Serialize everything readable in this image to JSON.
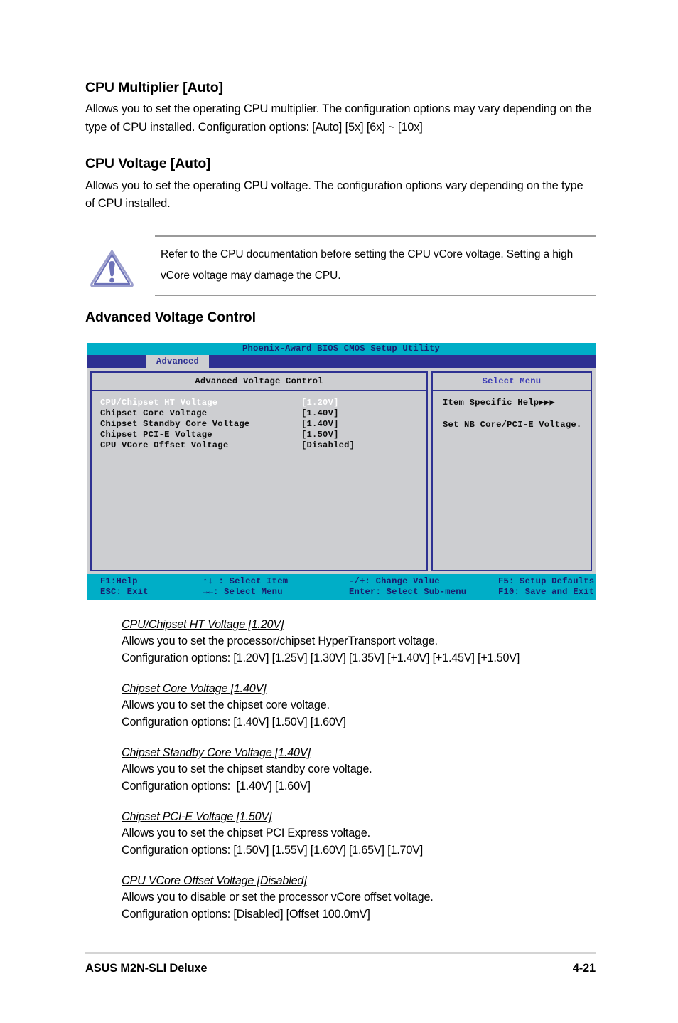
{
  "sections": [
    {
      "heading": "CPU Multiplier [Auto]",
      "body": "Allows you to set the operating CPU multiplier. The configuration options may vary depending on the type of CPU installed. Configuration options: [Auto] [5x] [6x] ~ [10x]"
    },
    {
      "heading": "CPU Voltage [Auto]",
      "body": "Allows you to set the operating CPU voltage. The configuration options vary depending on the type of CPU installed."
    }
  ],
  "note": {
    "icon": "warning-triangle-icon",
    "text": "Refer to the CPU documentation before setting the CPU vCore voltage. Setting a high vCore voltage may damage the CPU.",
    "icon_color": "#7b7fc4"
  },
  "advanced_heading": "Advanced Voltage Control",
  "bios": {
    "title": "Phoenix-Award BIOS CMOS Setup Utility",
    "tab": "Advanced",
    "left_pane_title": "Advanced Voltage Control",
    "right_pane_title": "Select Menu",
    "options": [
      {
        "label": "CPU/Chipset HT Voltage",
        "value": "[1.20V]",
        "selected": true
      },
      {
        "label": "Chipset Core Voltage",
        "value": "[1.40V]",
        "selected": false
      },
      {
        "label": "Chipset Standby Core Voltage",
        "value": "[1.40V]",
        "selected": false
      },
      {
        "label": "Chipset PCI-E Voltage",
        "value": "[1.50V]",
        "selected": false
      },
      {
        "label": "CPU VCore Offset Voltage",
        "value": "[Disabled]",
        "selected": false
      }
    ],
    "help_title": "Item Specific Help▶▶▶",
    "help_text": "Set NB Core/PCI-E Voltage.",
    "footer": {
      "row1": [
        "F1:Help",
        "↑↓ : Select Item",
        "-/+: Change Value",
        "F5: Setup Defaults"
      ],
      "row2": [
        "ESC: Exit",
        "→←: Select Menu",
        "Enter: Select Sub-menu",
        "F10: Save and Exit"
      ]
    },
    "colors": {
      "titlebar": "#00aec7",
      "tabbar": "#2e3192",
      "panel": "#cdced1",
      "border": "#2e3192",
      "footer": "#00aec7",
      "accent_text": "#3b3bb5"
    }
  },
  "details": [
    {
      "heading": "CPU/Chipset HT Voltage [1.20V]",
      "desc": "Allows you to set the processor/chipset HyperTransport voltage.",
      "options": "Configuration options: [1.20V] [1.25V] [1.30V] [1.35V] [+1.40V] [+1.45V] [+1.50V]"
    },
    {
      "heading": "Chipset Core Voltage [1.40V]",
      "desc": "Allows you to set the chipset core voltage.",
      "options": "Configuration options: [1.40V] [1.50V] [1.60V]"
    },
    {
      "heading": "Chipset Standby Core Voltage [1.40V]",
      "desc": "Allows you to set the chipset standby core voltage.",
      "options": "Configuration options:  [1.40V] [1.60V]"
    },
    {
      "heading": "Chipset PCI-E Voltage [1.50V]",
      "desc": "Allows you to set the chipset PCI Express voltage.",
      "options": "Configuration options: [1.50V] [1.55V] [1.60V] [1.65V] [1.70V]"
    },
    {
      "heading": "CPU VCore Offset Voltage [Disabled]",
      "desc": "Allows you to disable or set the processor vCore offset voltage.",
      "options": "Configuration options: [Disabled] [Offset 100.0mV]"
    }
  ],
  "page_footer": {
    "left": "ASUS M2N-SLI Deluxe",
    "right": "4-21"
  }
}
